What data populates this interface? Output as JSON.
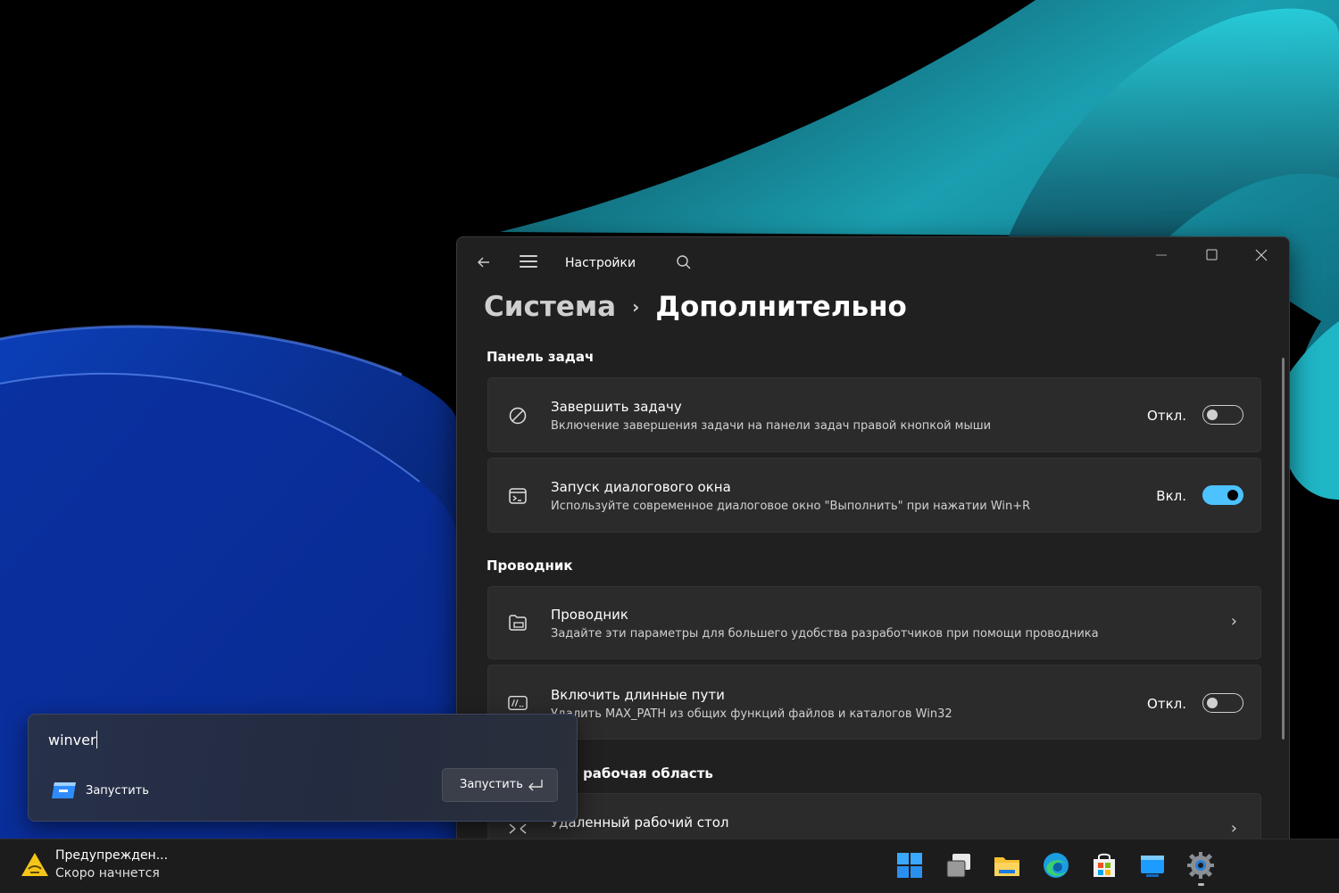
{
  "settings": {
    "app_title": "Настройки",
    "breadcrumb": {
      "parent": "Система",
      "separator": "›",
      "current": "Дополнительно"
    },
    "sections": [
      {
        "heading": "Панель задач"
      },
      {
        "heading": "Проводник"
      },
      {
        "heading": "рабочая область"
      }
    ],
    "items": [
      {
        "title": "Завершить задачу",
        "desc": "Включение завершения задачи на панели задач правой кнопкой мыши",
        "state": "Откл.",
        "toggle_on": false,
        "icon": "block-icon"
      },
      {
        "title": "Запуск диалогового окна",
        "desc": "Используйте современное диалоговое окно \"Выполнить\" при нажатии Win+R",
        "state": "Вкл.",
        "toggle_on": true,
        "icon": "terminal-icon"
      },
      {
        "title": "Проводник",
        "desc": "Задайте эти параметры для большего удобства разработчиков при помощи проводника",
        "icon": "folder-icon"
      },
      {
        "title": "Включить длинные пути",
        "desc": "Удалить MAX_PATH из общих функций файлов и каталогов Win32",
        "state": "Откл.",
        "toggle_on": false,
        "icon": "long-path-icon"
      },
      {
        "title": "Удаленный рабочий стол",
        "desc": "",
        "icon": "remote-desktop-icon"
      }
    ]
  },
  "run_dialog": {
    "input_value": "winver",
    "suggestion_label": "Запустить",
    "run_button_label": "Запустить"
  },
  "taskbar": {
    "notification_title": "Предупрежден...",
    "notification_subtitle": "Скоро начнется",
    "apps": [
      "windows-start-icon",
      "task-view-icon",
      "file-explorer-icon",
      "edge-icon",
      "store-icon",
      "app-window-icon",
      "settings-gear-icon"
    ]
  },
  "colors": {
    "accent": "#4cc2ff",
    "window_bg": "#202020",
    "card_bg": "#2b2b2b"
  }
}
